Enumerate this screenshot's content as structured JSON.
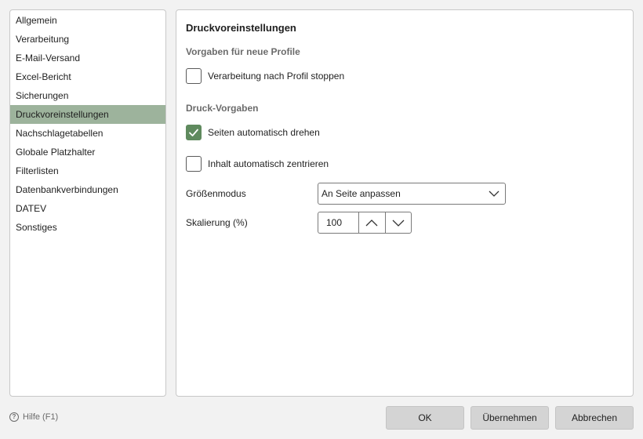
{
  "sidebar": {
    "items": [
      {
        "label": "Allgemein"
      },
      {
        "label": "Verarbeitung"
      },
      {
        "label": "E-Mail-Versand"
      },
      {
        "label": "Excel-Bericht"
      },
      {
        "label": "Sicherungen"
      },
      {
        "label": "Druckvoreinstellungen",
        "selected": true
      },
      {
        "label": "Nachschlagetabellen"
      },
      {
        "label": "Globale Platzhalter"
      },
      {
        "label": "Filterlisten"
      },
      {
        "label": "Datenbankverbindungen"
      },
      {
        "label": "DATEV"
      },
      {
        "label": "Sonstiges"
      }
    ]
  },
  "panel": {
    "title": "Druckvoreinstellungen",
    "section_profiles": "Vorgaben für neue Profile",
    "stop_after_profile": {
      "label": "Verarbeitung nach Profil stoppen",
      "checked": false
    },
    "section_print": "Druck-Vorgaben",
    "auto_rotate": {
      "label": "Seiten automatisch drehen",
      "checked": true
    },
    "auto_center": {
      "label": "Inhalt automatisch zentrieren",
      "checked": false
    },
    "size_mode": {
      "label": "Größenmodus",
      "value": "An Seite anpassen"
    },
    "scaling": {
      "label": "Skalierung (%)",
      "value": "100"
    }
  },
  "footer": {
    "help_label": "Hilfe (F1)",
    "ok_label": "OK",
    "apply_label": "Übernehmen",
    "cancel_label": "Abbrechen"
  },
  "colors": {
    "selected_bg": "#9db39c",
    "checkbox_checked": "#5f8a5e",
    "button_bg": "#d4d4d4"
  }
}
